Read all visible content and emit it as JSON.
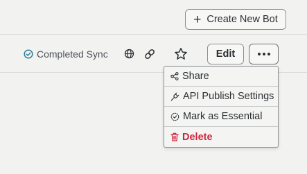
{
  "header": {
    "create_label": "Create New Bot"
  },
  "toolbar": {
    "sync_status": "Completed Sync",
    "edit_label": "Edit"
  },
  "menu": {
    "items": [
      {
        "label": "Share",
        "icon": "share-icon"
      },
      {
        "label": "API Publish Settings",
        "icon": "plug-icon"
      },
      {
        "label": "Mark as Essential",
        "icon": "badge-check-icon"
      },
      {
        "label": "Delete",
        "icon": "trash-icon",
        "danger": true
      }
    ]
  },
  "colors": {
    "accent_sync": "#2a7e9c",
    "danger": "#d1243a"
  }
}
